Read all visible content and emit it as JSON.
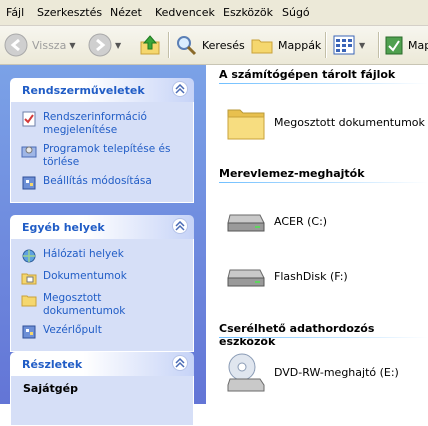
{
  "menubar": {
    "items": [
      "Fájl",
      "Szerkesztés",
      "Nézet",
      "Kedvencek",
      "Eszközök",
      "Súgó"
    ]
  },
  "toolbar": {
    "back_label": "Vissza",
    "search_label": "Keresés",
    "folders_label": "Mappák",
    "extra_label": "Map"
  },
  "left_pane": {
    "system_tasks": {
      "title": "Rendszerműveletek",
      "links": [
        "Rendszerinformáció megjelenítése",
        "Programok telepítése és törlése",
        "Beállítás módosítása"
      ]
    },
    "other_places": {
      "title": "Egyéb helyek",
      "links": [
        "Hálózati helyek",
        "Dokumentumok",
        "Megosztott dokumentumok",
        "Vezérlőpult"
      ]
    },
    "details": {
      "title": "Részletek",
      "name": "Sajátgép"
    }
  },
  "main": {
    "groups": [
      {
        "title": "A számítógépen tárolt fájlok",
        "items": [
          "Megosztott dokumentumok"
        ]
      },
      {
        "title": "Merevlemez-meghajtók",
        "items": [
          "ACER (C:)",
          "FlashDisk (F:)"
        ]
      },
      {
        "title": "Cserélhető adathordozós eszközök",
        "items": [
          "DVD-RW-meghajtó (E:)"
        ]
      }
    ]
  },
  "colors": {
    "task_link": "#215dc6",
    "pane_gradient_top": "#7ba2e7",
    "pane_gradient_bottom": "#6375d6",
    "panel_body": "#d6dff7",
    "folder_yellow": "#f5d76e"
  }
}
